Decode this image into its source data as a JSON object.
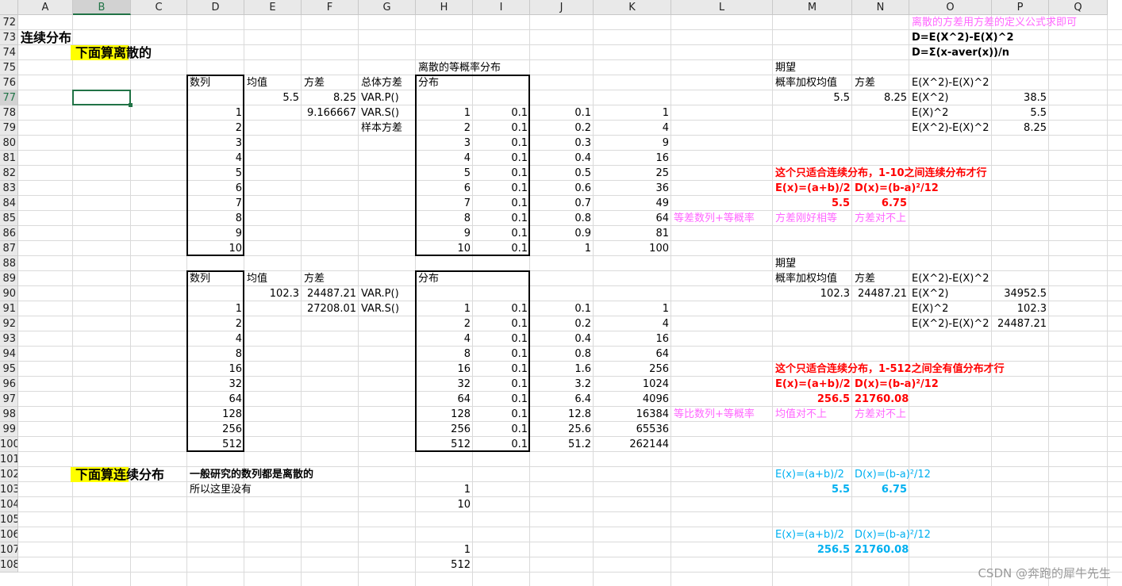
{
  "columns": [
    "A",
    "B",
    "C",
    "D",
    "E",
    "F",
    "G",
    "H",
    "I",
    "J",
    "K",
    "L",
    "M",
    "N",
    "O",
    "P",
    "Q"
  ],
  "selected_column": "B",
  "rows": [
    "72",
    "73",
    "74",
    "75",
    "76",
    "77",
    "78",
    "79",
    "80",
    "81",
    "82",
    "83",
    "84",
    "85",
    "86",
    "87",
    "88",
    "89",
    "90",
    "91",
    "92",
    "93",
    "94",
    "95",
    "96",
    "97",
    "98",
    "99",
    "100",
    "101",
    "102",
    "103",
    "104",
    "105",
    "106",
    "107",
    "108"
  ],
  "selected_row": "77",
  "selected_cell": "B77",
  "colors": {
    "red": "#ff0000",
    "pink": "#ff66ff",
    "blue": "#00b0f0",
    "highlight": "#ffff00",
    "selection": "#217346"
  },
  "watermark": "CSDN @奔跑的犀牛先生",
  "cells": [
    {
      "c": "O",
      "r": 72,
      "v": "离散的方差用方差的定义公式求即可",
      "color": "#ff66ff"
    },
    {
      "c": "A",
      "r": 73,
      "v": "连续分布",
      "bold": true,
      "size": 16
    },
    {
      "c": "O",
      "r": 73,
      "v": "D=E(X^2)-E(X)^2",
      "bold": true
    },
    {
      "c": "B",
      "r": 74,
      "v": "下面算离散的",
      "bold": true,
      "size": 16,
      "hlw": 70
    },
    {
      "c": "O",
      "r": 74,
      "v": "D=Σ(x-aver(x))/n",
      "bold": true
    },
    {
      "c": "H",
      "r": 75,
      "v": "离散的等概率分布"
    },
    {
      "c": "M",
      "r": 75,
      "v": "期望"
    },
    {
      "c": "D",
      "r": 76,
      "v": "数列"
    },
    {
      "c": "E",
      "r": 76,
      "v": "均值"
    },
    {
      "c": "F",
      "r": 76,
      "v": "方差"
    },
    {
      "c": "G",
      "r": 76,
      "v": "总体方差"
    },
    {
      "c": "H",
      "r": 76,
      "v": "分布"
    },
    {
      "c": "M",
      "r": 76,
      "v": "概率加权均值"
    },
    {
      "c": "N",
      "r": 76,
      "v": "方差"
    },
    {
      "c": "O",
      "r": 76,
      "v": "E(X^2)-E(X)^2"
    },
    {
      "c": "E",
      "r": 77,
      "v": "5.5",
      "num": true
    },
    {
      "c": "F",
      "r": 77,
      "v": "8.25",
      "num": true
    },
    {
      "c": "G",
      "r": 77,
      "v": "VAR.P()"
    },
    {
      "c": "M",
      "r": 77,
      "v": "5.5",
      "num": true
    },
    {
      "c": "N",
      "r": 77,
      "v": "8.25",
      "num": true
    },
    {
      "c": "O",
      "r": 77,
      "v": "E(X^2)"
    },
    {
      "c": "P",
      "r": 77,
      "v": "38.5",
      "num": true
    },
    {
      "c": "D",
      "r": 78,
      "v": "1",
      "num": true
    },
    {
      "c": "F",
      "r": 78,
      "v": "9.166667",
      "num": true
    },
    {
      "c": "G",
      "r": 78,
      "v": "VAR.S()"
    },
    {
      "c": "H",
      "r": 78,
      "v": "1",
      "num": true
    },
    {
      "c": "I",
      "r": 78,
      "v": "0.1",
      "num": true
    },
    {
      "c": "J",
      "r": 78,
      "v": "0.1",
      "num": true
    },
    {
      "c": "K",
      "r": 78,
      "v": "1",
      "num": true
    },
    {
      "c": "O",
      "r": 78,
      "v": "E(X)^2"
    },
    {
      "c": "P",
      "r": 78,
      "v": "5.5",
      "num": true
    },
    {
      "c": "D",
      "r": 79,
      "v": "2",
      "num": true
    },
    {
      "c": "G",
      "r": 79,
      "v": "样本方差"
    },
    {
      "c": "H",
      "r": 79,
      "v": "2",
      "num": true
    },
    {
      "c": "I",
      "r": 79,
      "v": "0.1",
      "num": true
    },
    {
      "c": "J",
      "r": 79,
      "v": "0.2",
      "num": true
    },
    {
      "c": "K",
      "r": 79,
      "v": "4",
      "num": true
    },
    {
      "c": "O",
      "r": 79,
      "v": "E(X^2)-E(X)^2"
    },
    {
      "c": "P",
      "r": 79,
      "v": "8.25",
      "num": true
    },
    {
      "c": "D",
      "r": 80,
      "v": "3",
      "num": true
    },
    {
      "c": "H",
      "r": 80,
      "v": "3",
      "num": true
    },
    {
      "c": "I",
      "r": 80,
      "v": "0.1",
      "num": true
    },
    {
      "c": "J",
      "r": 80,
      "v": "0.3",
      "num": true
    },
    {
      "c": "K",
      "r": 80,
      "v": "9",
      "num": true
    },
    {
      "c": "D",
      "r": 81,
      "v": "4",
      "num": true
    },
    {
      "c": "H",
      "r": 81,
      "v": "4",
      "num": true
    },
    {
      "c": "I",
      "r": 81,
      "v": "0.1",
      "num": true
    },
    {
      "c": "J",
      "r": 81,
      "v": "0.4",
      "num": true
    },
    {
      "c": "K",
      "r": 81,
      "v": "16",
      "num": true
    },
    {
      "c": "D",
      "r": 82,
      "v": "5",
      "num": true
    },
    {
      "c": "H",
      "r": 82,
      "v": "5",
      "num": true
    },
    {
      "c": "I",
      "r": 82,
      "v": "0.1",
      "num": true
    },
    {
      "c": "J",
      "r": 82,
      "v": "0.5",
      "num": true
    },
    {
      "c": "K",
      "r": 82,
      "v": "25",
      "num": true
    },
    {
      "c": "M",
      "r": 82,
      "v": "这个只适合连续分布，1-10之间连续分布才行",
      "color": "#ff0000",
      "bold": true
    },
    {
      "c": "D",
      "r": 83,
      "v": "6",
      "num": true
    },
    {
      "c": "H",
      "r": 83,
      "v": "6",
      "num": true
    },
    {
      "c": "I",
      "r": 83,
      "v": "0.1",
      "num": true
    },
    {
      "c": "J",
      "r": 83,
      "v": "0.6",
      "num": true
    },
    {
      "c": "K",
      "r": 83,
      "v": "36",
      "num": true
    },
    {
      "c": "M",
      "r": 83,
      "v": "E(x)=(a+b)/2",
      "color": "#ff0000",
      "bold": true
    },
    {
      "c": "N",
      "r": 83,
      "v": "D(x)=(b-a)²/12",
      "color": "#ff0000",
      "bold": true
    },
    {
      "c": "D",
      "r": 84,
      "v": "7",
      "num": true
    },
    {
      "c": "H",
      "r": 84,
      "v": "7",
      "num": true
    },
    {
      "c": "I",
      "r": 84,
      "v": "0.1",
      "num": true
    },
    {
      "c": "J",
      "r": 84,
      "v": "0.7",
      "num": true
    },
    {
      "c": "K",
      "r": 84,
      "v": "49",
      "num": true
    },
    {
      "c": "M",
      "r": 84,
      "v": "5.5",
      "num": true,
      "color": "#ff0000",
      "bold": true
    },
    {
      "c": "N",
      "r": 84,
      "v": "6.75",
      "num": true,
      "color": "#ff0000",
      "bold": true
    },
    {
      "c": "D",
      "r": 85,
      "v": "8",
      "num": true
    },
    {
      "c": "H",
      "r": 85,
      "v": "8",
      "num": true
    },
    {
      "c": "I",
      "r": 85,
      "v": "0.1",
      "num": true
    },
    {
      "c": "J",
      "r": 85,
      "v": "0.8",
      "num": true
    },
    {
      "c": "K",
      "r": 85,
      "v": "64",
      "num": true
    },
    {
      "c": "L",
      "r": 85,
      "v": "等差数列+等概率",
      "color": "#ff66ff"
    },
    {
      "c": "M",
      "r": 85,
      "v": "方差刚好相等",
      "color": "#ff66ff"
    },
    {
      "c": "N",
      "r": 85,
      "v": "方差对不上",
      "color": "#ff66ff"
    },
    {
      "c": "D",
      "r": 86,
      "v": "9",
      "num": true
    },
    {
      "c": "H",
      "r": 86,
      "v": "9",
      "num": true
    },
    {
      "c": "I",
      "r": 86,
      "v": "0.1",
      "num": true
    },
    {
      "c": "J",
      "r": 86,
      "v": "0.9",
      "num": true
    },
    {
      "c": "K",
      "r": 86,
      "v": "81",
      "num": true
    },
    {
      "c": "D",
      "r": 87,
      "v": "10",
      "num": true
    },
    {
      "c": "H",
      "r": 87,
      "v": "10",
      "num": true
    },
    {
      "c": "I",
      "r": 87,
      "v": "0.1",
      "num": true
    },
    {
      "c": "J",
      "r": 87,
      "v": "1",
      "num": true
    },
    {
      "c": "K",
      "r": 87,
      "v": "100",
      "num": true
    },
    {
      "c": "M",
      "r": 88,
      "v": "期望"
    },
    {
      "c": "D",
      "r": 89,
      "v": "数列"
    },
    {
      "c": "E",
      "r": 89,
      "v": "均值"
    },
    {
      "c": "F",
      "r": 89,
      "v": "方差"
    },
    {
      "c": "H",
      "r": 89,
      "v": "分布"
    },
    {
      "c": "M",
      "r": 89,
      "v": "概率加权均值"
    },
    {
      "c": "N",
      "r": 89,
      "v": "方差"
    },
    {
      "c": "O",
      "r": 89,
      "v": "E(X^2)-E(X)^2"
    },
    {
      "c": "E",
      "r": 90,
      "v": "102.3",
      "num": true
    },
    {
      "c": "F",
      "r": 90,
      "v": "24487.21",
      "num": true
    },
    {
      "c": "G",
      "r": 90,
      "v": "VAR.P()"
    },
    {
      "c": "M",
      "r": 90,
      "v": "102.3",
      "num": true
    },
    {
      "c": "N",
      "r": 90,
      "v": "24487.21",
      "num": true
    },
    {
      "c": "O",
      "r": 90,
      "v": "E(X^2)"
    },
    {
      "c": "P",
      "r": 90,
      "v": "34952.5",
      "num": true
    },
    {
      "c": "D",
      "r": 91,
      "v": "1",
      "num": true
    },
    {
      "c": "F",
      "r": 91,
      "v": "27208.01",
      "num": true
    },
    {
      "c": "G",
      "r": 91,
      "v": "VAR.S()"
    },
    {
      "c": "H",
      "r": 91,
      "v": "1",
      "num": true
    },
    {
      "c": "I",
      "r": 91,
      "v": "0.1",
      "num": true
    },
    {
      "c": "J",
      "r": 91,
      "v": "0.1",
      "num": true
    },
    {
      "c": "K",
      "r": 91,
      "v": "1",
      "num": true
    },
    {
      "c": "O",
      "r": 91,
      "v": "E(X)^2"
    },
    {
      "c": "P",
      "r": 91,
      "v": "102.3",
      "num": true
    },
    {
      "c": "D",
      "r": 92,
      "v": "2",
      "num": true
    },
    {
      "c": "H",
      "r": 92,
      "v": "2",
      "num": true
    },
    {
      "c": "I",
      "r": 92,
      "v": "0.1",
      "num": true
    },
    {
      "c": "J",
      "r": 92,
      "v": "0.2",
      "num": true
    },
    {
      "c": "K",
      "r": 92,
      "v": "4",
      "num": true
    },
    {
      "c": "O",
      "r": 92,
      "v": "E(X^2)-E(X)^2"
    },
    {
      "c": "P",
      "r": 92,
      "v": "24487.21",
      "num": true
    },
    {
      "c": "D",
      "r": 93,
      "v": "4",
      "num": true
    },
    {
      "c": "H",
      "r": 93,
      "v": "4",
      "num": true
    },
    {
      "c": "I",
      "r": 93,
      "v": "0.1",
      "num": true
    },
    {
      "c": "J",
      "r": 93,
      "v": "0.4",
      "num": true
    },
    {
      "c": "K",
      "r": 93,
      "v": "16",
      "num": true
    },
    {
      "c": "D",
      "r": 94,
      "v": "8",
      "num": true
    },
    {
      "c": "H",
      "r": 94,
      "v": "8",
      "num": true
    },
    {
      "c": "I",
      "r": 94,
      "v": "0.1",
      "num": true
    },
    {
      "c": "J",
      "r": 94,
      "v": "0.8",
      "num": true
    },
    {
      "c": "K",
      "r": 94,
      "v": "64",
      "num": true
    },
    {
      "c": "D",
      "r": 95,
      "v": "16",
      "num": true
    },
    {
      "c": "H",
      "r": 95,
      "v": "16",
      "num": true
    },
    {
      "c": "I",
      "r": 95,
      "v": "0.1",
      "num": true
    },
    {
      "c": "J",
      "r": 95,
      "v": "1.6",
      "num": true
    },
    {
      "c": "K",
      "r": 95,
      "v": "256",
      "num": true
    },
    {
      "c": "M",
      "r": 95,
      "v": "这个只适合连续分布，1-512之间全有值分布才行",
      "color": "#ff0000",
      "bold": true
    },
    {
      "c": "D",
      "r": 96,
      "v": "32",
      "num": true
    },
    {
      "c": "H",
      "r": 96,
      "v": "32",
      "num": true
    },
    {
      "c": "I",
      "r": 96,
      "v": "0.1",
      "num": true
    },
    {
      "c": "J",
      "r": 96,
      "v": "3.2",
      "num": true
    },
    {
      "c": "K",
      "r": 96,
      "v": "1024",
      "num": true
    },
    {
      "c": "M",
      "r": 96,
      "v": "E(x)=(a+b)/2",
      "color": "#ff0000",
      "bold": true
    },
    {
      "c": "N",
      "r": 96,
      "v": "D(x)=(b-a)²/12",
      "color": "#ff0000",
      "bold": true
    },
    {
      "c": "D",
      "r": 97,
      "v": "64",
      "num": true
    },
    {
      "c": "H",
      "r": 97,
      "v": "64",
      "num": true
    },
    {
      "c": "I",
      "r": 97,
      "v": "0.1",
      "num": true
    },
    {
      "c": "J",
      "r": 97,
      "v": "6.4",
      "num": true
    },
    {
      "c": "K",
      "r": 97,
      "v": "4096",
      "num": true
    },
    {
      "c": "M",
      "r": 97,
      "v": "256.5",
      "num": true,
      "color": "#ff0000",
      "bold": true
    },
    {
      "c": "N",
      "r": 97,
      "v": "21760.08",
      "num": true,
      "color": "#ff0000",
      "bold": true
    },
    {
      "c": "D",
      "r": 98,
      "v": "128",
      "num": true
    },
    {
      "c": "H",
      "r": 98,
      "v": "128",
      "num": true
    },
    {
      "c": "I",
      "r": 98,
      "v": "0.1",
      "num": true
    },
    {
      "c": "J",
      "r": 98,
      "v": "12.8",
      "num": true
    },
    {
      "c": "K",
      "r": 98,
      "v": "16384",
      "num": true
    },
    {
      "c": "L",
      "r": 98,
      "v": "等比数列+等概率",
      "color": "#ff66ff"
    },
    {
      "c": "M",
      "r": 98,
      "v": "均值对不上",
      "color": "#ff66ff"
    },
    {
      "c": "N",
      "r": 98,
      "v": "方差对不上",
      "color": "#ff66ff"
    },
    {
      "c": "D",
      "r": 99,
      "v": "256",
      "num": true
    },
    {
      "c": "H",
      "r": 99,
      "v": "256",
      "num": true
    },
    {
      "c": "I",
      "r": 99,
      "v": "0.1",
      "num": true
    },
    {
      "c": "J",
      "r": 99,
      "v": "25.6",
      "num": true
    },
    {
      "c": "K",
      "r": 99,
      "v": "65536",
      "num": true
    },
    {
      "c": "D",
      "r": 100,
      "v": "512",
      "num": true
    },
    {
      "c": "H",
      "r": 100,
      "v": "512",
      "num": true
    },
    {
      "c": "I",
      "r": 100,
      "v": "0.1",
      "num": true
    },
    {
      "c": "J",
      "r": 100,
      "v": "51.2",
      "num": true
    },
    {
      "c": "K",
      "r": 100,
      "v": "262144",
      "num": true
    },
    {
      "c": "B",
      "r": 102,
      "v": "下面算连续分布",
      "bold": true,
      "size": 16,
      "hlw": 70
    },
    {
      "c": "D",
      "r": 102,
      "v": "一般研究的数列都是离散的",
      "bold": true
    },
    {
      "c": "M",
      "r": 102,
      "v": "E(x)=(a+b)/2",
      "color": "#00b0f0"
    },
    {
      "c": "N",
      "r": 102,
      "v": "D(x)=(b-a)²/12",
      "color": "#00b0f0"
    },
    {
      "c": "D",
      "r": 103,
      "v": "所以这里没有"
    },
    {
      "c": "H",
      "r": 103,
      "v": "1",
      "num": true
    },
    {
      "c": "M",
      "r": 103,
      "v": "5.5",
      "num": true,
      "color": "#00b0f0",
      "bold": true
    },
    {
      "c": "N",
      "r": 103,
      "v": "6.75",
      "num": true,
      "color": "#00b0f0",
      "bold": true
    },
    {
      "c": "H",
      "r": 104,
      "v": "10",
      "num": true
    },
    {
      "c": "M",
      "r": 106,
      "v": "E(x)=(a+b)/2",
      "color": "#00b0f0"
    },
    {
      "c": "N",
      "r": 106,
      "v": "D(x)=(b-a)²/12",
      "color": "#00b0f0"
    },
    {
      "c": "H",
      "r": 107,
      "v": "1",
      "num": true
    },
    {
      "c": "M",
      "r": 107,
      "v": "256.5",
      "num": true,
      "color": "#00b0f0",
      "bold": true
    },
    {
      "c": "N",
      "r": 107,
      "v": "21760.08",
      "num": true,
      "color": "#00b0f0",
      "bold": true
    },
    {
      "c": "H",
      "r": 108,
      "v": "512",
      "num": true
    }
  ]
}
